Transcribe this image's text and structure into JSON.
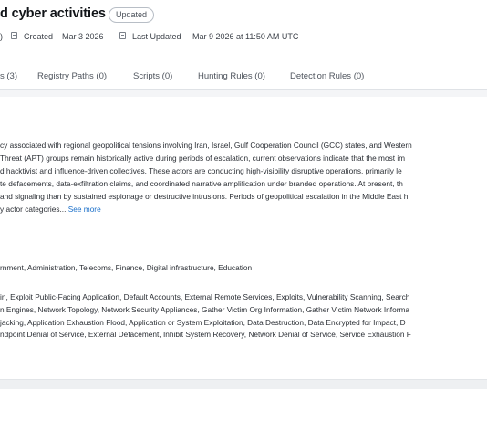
{
  "header": {
    "title": "d cyber activities",
    "badge": "Updated",
    "meta": {
      "partial_left": ")",
      "created_label": "Created",
      "created_value": "Mar 3 2026",
      "updated_label": "Last Updated",
      "updated_value": "Mar 9 2026 at 11:50 AM UTC"
    }
  },
  "tabs": [
    {
      "label": "s (3)"
    },
    {
      "label": "Registry Paths (0)"
    },
    {
      "label": "Scripts (0)"
    },
    {
      "label": "Hunting Rules (0)"
    },
    {
      "label": "Detection Rules (0)"
    }
  ],
  "description": {
    "lines": [
      "cy associated with regional geopolitical tensions involving Iran, Israel, Gulf Cooperation Council (GCC) states, and Western",
      "Threat (APT) groups remain historically active during periods of escalation, current observations indicate that the most im",
      "d hacktivist and influence-driven collectives. These actors are conducting high-visibility disruptive operations, primarily le",
      "te defacements, data-exfiltration claims, and coordinated narrative amplification under branded operations. At present, th",
      "and signaling than by sustained espionage or destructive intrusions. Periods of geopolitical escalation in the Middle East h",
      "y actor categories..."
    ],
    "see_more": "See more"
  },
  "sectors": "rnment, Administration, Telecoms, Finance, Digital infrastructure, Education",
  "techniques": [
    "in, Exploit Public-Facing Application, Default Accounts, External Remote Services, Exploits, Vulnerability Scanning, Search",
    "n Engines, Network Topology, Network Security Appliances, Gather Victim Org Information, Gather Victim Network Informa",
    "jacking, Application Exhaustion Flood, Application or System Exploitation, Data Destruction, Data Encrypted for Impact, D",
    "ndpoint Denial of Service, External Defacement, Inhibit System Recovery, Network Denial of Service, Service Exhaustion F"
  ]
}
